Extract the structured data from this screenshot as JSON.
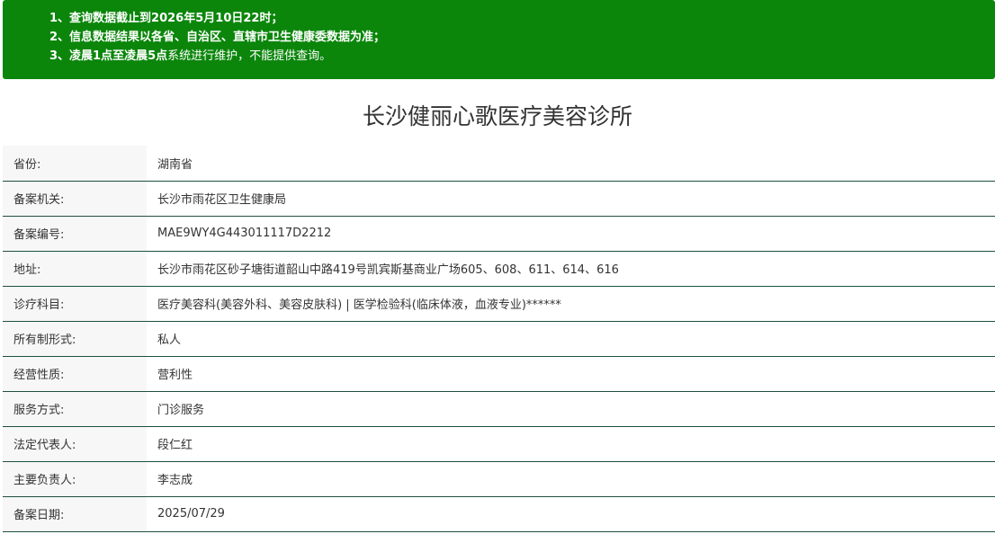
{
  "notice": {
    "line1_prefix": "1、查询数据截止到",
    "line1_date": "2026年5月10日22时",
    "line1_suffix": "；",
    "line2": "2、信息数据结果以各省、自治区、直辖市卫生健康委数据为准；",
    "line3_prefix": "3、",
    "line3_bold": "凌晨1点至凌晨5点",
    "line3_suffix": "系统进行维护，不能提供查询。"
  },
  "title": "长沙健丽心歌医疗美容诊所",
  "rows": [
    {
      "label": "省份:",
      "value": "湖南省"
    },
    {
      "label": "备案机关:",
      "value": "长沙市雨花区卫生健康局"
    },
    {
      "label": "备案编号:",
      "value": "MAE9WY4G443011117D2212"
    },
    {
      "label": "地址:",
      "value": "长沙市雨花区砂子塘街道韶山中路419号凯宾斯基商业广场605、608、611、614、616"
    },
    {
      "label": "诊疗科目:",
      "value": "医疗美容科(美容外科、美容皮肤科) | 医学检验科(临床体液，血液专业)******"
    },
    {
      "label": "所有制形式:",
      "value": "私人"
    },
    {
      "label": "经营性质:",
      "value": "营利性"
    },
    {
      "label": "服务方式:",
      "value": "门诊服务"
    },
    {
      "label": "法定代表人:",
      "value": "段仁红"
    },
    {
      "label": "主要负责人:",
      "value": "李志成"
    },
    {
      "label": "备案日期:",
      "value": "2025/07/29"
    }
  ],
  "colors": {
    "notice_bg": "#0b860b",
    "row_border": "#1f4f3f",
    "label_bg": "#f7f7f7"
  }
}
